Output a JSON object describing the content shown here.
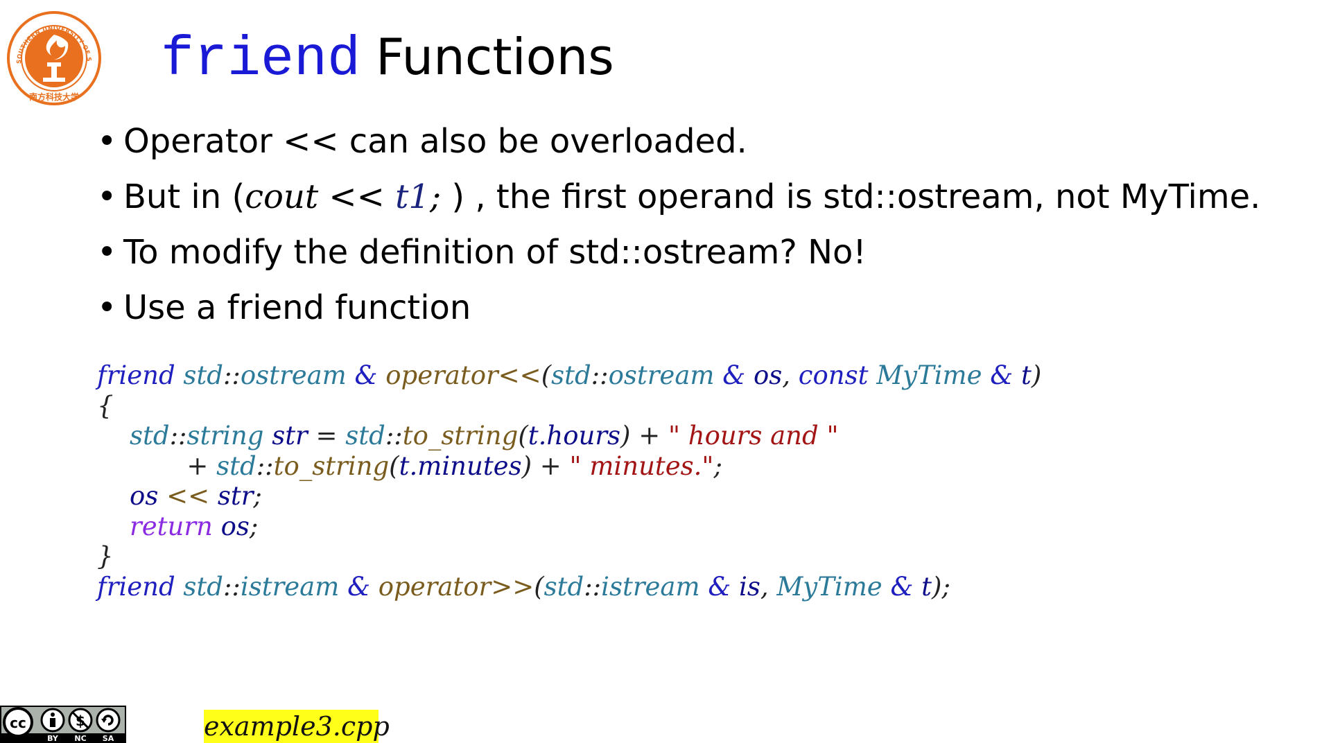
{
  "logo": {
    "name": "university-seal",
    "ring_text": "SOUTHERN UNIVERSITY OF SCIENCE AND TECHNOLOGY",
    "chinese_text": "南方科技大学",
    "colors": {
      "primary": "#e8701e"
    }
  },
  "title": {
    "keyword": "friend",
    "rest": "Functions"
  },
  "bullets": {
    "b1": "Operator << can also be overloaded.",
    "b2_prefix": "But in (",
    "b2_code_a": "cout",
    "b2_code_b": " << ",
    "b2_code_c": "t1",
    "b2_code_d": ";",
    "b2_suffix": " ) , the first operand is std::ostream, not MyTime.",
    "b3": "To modify the definition of std::ostream? No!",
    "b4": "Use a friend function"
  },
  "code": {
    "l1": {
      "friend": "friend",
      "std1": "std",
      "sep1": "::",
      "ostream1": "ostream",
      "amp1": " & ",
      "op": "operator<<",
      "paren": "(",
      "std2": "std",
      "sep2": "::",
      "ostream2": "ostream",
      "amp2": " & ",
      "os": "os",
      "comma": ", ",
      "const": "const",
      "mytime": "MyTime",
      "amp3": " & ",
      "t": "t",
      "close": ")"
    },
    "l2": {
      "brace": "{"
    },
    "l3": {
      "std1": "std",
      "sep1": "::",
      "string": "string",
      "var": "str",
      "eq": " = ",
      "std2": "std",
      "sep2": "::",
      "fn": "to_string",
      "open": "(",
      "t": "t.hours",
      "close": ")",
      "plus": " + ",
      "str": "\" hours and \""
    },
    "l4": {
      "plus1": "+ ",
      "std": "std",
      "sep": "::",
      "fn": "to_string",
      "open": "(",
      "t": "t.minutes",
      "close": ")",
      "plus2": " + ",
      "str": "\" minutes.\"",
      "semi": ";"
    },
    "l5": {
      "os": "os",
      "op": " << ",
      "str": "str",
      "semi": ";"
    },
    "l6": {
      "ret": "return",
      "os": "os",
      "semi": ";"
    },
    "l7": {
      "brace": "}"
    },
    "l8": {
      "friend": "friend",
      "std1": "std",
      "sep1": "::",
      "istream1": "istream",
      "amp1": " & ",
      "op": "operator>>",
      "paren": "(",
      "std2": "std",
      "sep2": "::",
      "istream2": "istream",
      "amp2": " & ",
      "is": "is",
      "comma": ", ",
      "mytime": "MyTime",
      "amp3": " & ",
      "t": "t",
      "close": ");"
    }
  },
  "footer": {
    "license": {
      "icon": "cc-by-nc-sa-icon",
      "by": "BY",
      "nc": "NC",
      "sa": "SA"
    },
    "filename": "example3.cpp"
  }
}
